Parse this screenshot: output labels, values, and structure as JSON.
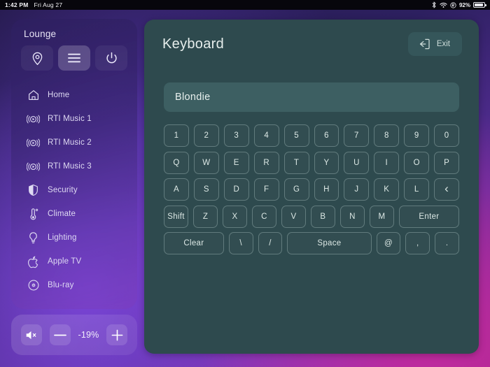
{
  "statusbar": {
    "time": "1:42 PM",
    "date": "Fri Aug 27",
    "battery_percent": "92%",
    "icons": [
      "bluetooth-icon",
      "wifi-icon",
      "rotation-lock-icon",
      "battery-icon"
    ]
  },
  "sidebar": {
    "room": "Lounge",
    "controls": [
      {
        "name": "location-icon",
        "label": "Location",
        "active": false
      },
      {
        "name": "menu-icon",
        "label": "Menu",
        "active": true
      },
      {
        "name": "power-icon",
        "label": "Power",
        "active": false
      }
    ],
    "items": [
      {
        "label": "Home",
        "icon": "home-icon"
      },
      {
        "label": "RTI Music 1",
        "icon": "music-stream-icon"
      },
      {
        "label": "RTI Music 2",
        "icon": "music-stream-icon"
      },
      {
        "label": "RTI Music 3",
        "icon": "music-stream-icon"
      },
      {
        "label": "Security",
        "icon": "shield-icon"
      },
      {
        "label": "Climate",
        "icon": "thermometer-icon"
      },
      {
        "label": "Lighting",
        "icon": "lightbulb-icon"
      },
      {
        "label": "Apple TV",
        "icon": "apple-icon"
      },
      {
        "label": "Blu-ray",
        "icon": "disc-icon"
      }
    ]
  },
  "volume": {
    "mute_label": "Mute",
    "minus_label": "—",
    "level": "-19%",
    "plus_label": "+"
  },
  "main": {
    "title": "Keyboard",
    "exit_label": "Exit",
    "input_value": "Blondie",
    "input_placeholder": "",
    "rows": [
      [
        "1",
        "2",
        "3",
        "4",
        "5",
        "6",
        "7",
        "8",
        "9",
        "0"
      ],
      [
        "Q",
        "W",
        "E",
        "R",
        "T",
        "Y",
        "U",
        "I",
        "O",
        "P"
      ],
      [
        "A",
        "S",
        "D",
        "F",
        "G",
        "H",
        "J",
        "K",
        "L",
        "‹"
      ],
      [
        "Shift",
        "Z",
        "X",
        "C",
        "V",
        "B",
        "N",
        "M",
        "Enter"
      ],
      [
        "Clear",
        "\\",
        "/",
        "Space",
        "@",
        ",",
        "."
      ]
    ]
  },
  "colors": {
    "panel_bg": "#2e4a4e",
    "input_bg": "#3d5f62",
    "exit_bg": "#35565a",
    "key_text": "#dce8e5",
    "sidebar_text": "#ded9f2"
  }
}
